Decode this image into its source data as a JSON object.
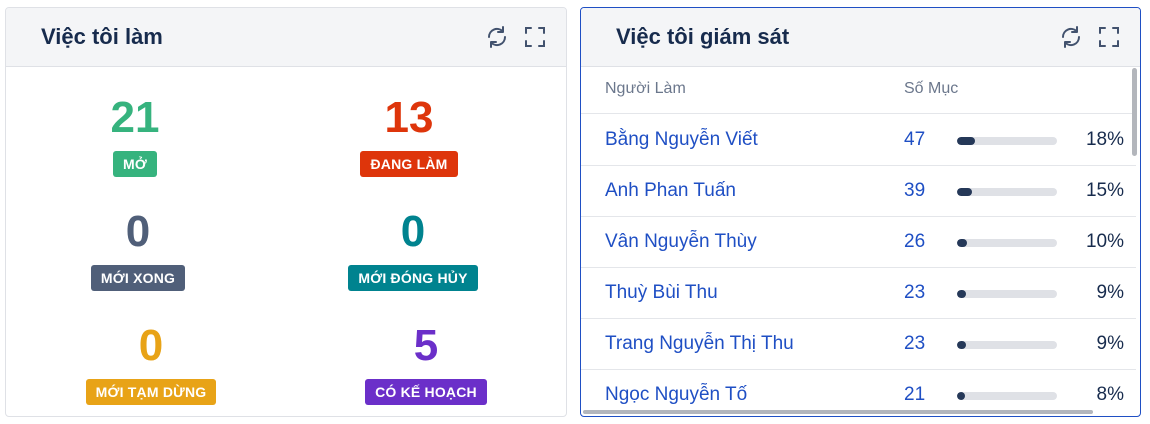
{
  "left_panel": {
    "title": "Việc tôi làm",
    "stats": [
      {
        "value": "21",
        "label": "MỞ",
        "color": "#36b37e",
        "badge_color": "#36b37e"
      },
      {
        "value": "13",
        "label": "ĐANG LÀM",
        "color": "#de350b",
        "badge_color": "#de350b"
      },
      {
        "value": "0",
        "label": "MỚI XONG",
        "color": "#505f79",
        "badge_color": "#505f79"
      },
      {
        "value": "0",
        "label": "MỚI ĐÓNG HỦY",
        "color": "#00838f",
        "badge_color": "#00838f"
      },
      {
        "value": "0",
        "label": "MỚI TẠM DỪNG",
        "color": "#e8a317",
        "badge_color": "#e8a317"
      },
      {
        "value": "5",
        "label": "CÓ KẾ HOẠCH",
        "color": "#6b2fc9",
        "badge_color": "#6b2fc9"
      }
    ]
  },
  "right_panel": {
    "title": "Việc tôi giám sát",
    "columns": {
      "assignee": "Người Làm",
      "count": "Số Mục"
    },
    "rows": [
      {
        "name": "Bằng Nguyễn Viết",
        "count": "47",
        "percent": "18%",
        "fraction": 0.18
      },
      {
        "name": "Anh Phan Tuấn",
        "count": "39",
        "percent": "15%",
        "fraction": 0.15
      },
      {
        "name": "Vân Nguyễn Thùy",
        "count": "26",
        "percent": "10%",
        "fraction": 0.1
      },
      {
        "name": "Thuỳ Bùi Thu",
        "count": "23",
        "percent": "9%",
        "fraction": 0.09
      },
      {
        "name": "Trang Nguyễn Thị Thu",
        "count": "23",
        "percent": "9%",
        "fraction": 0.09
      },
      {
        "name": "Ngọc Nguyễn Tố",
        "count": "21",
        "percent": "8%",
        "fraction": 0.08
      }
    ]
  },
  "icons": {
    "refresh": "refresh-icon",
    "fullscreen": "fullscreen-icon"
  }
}
